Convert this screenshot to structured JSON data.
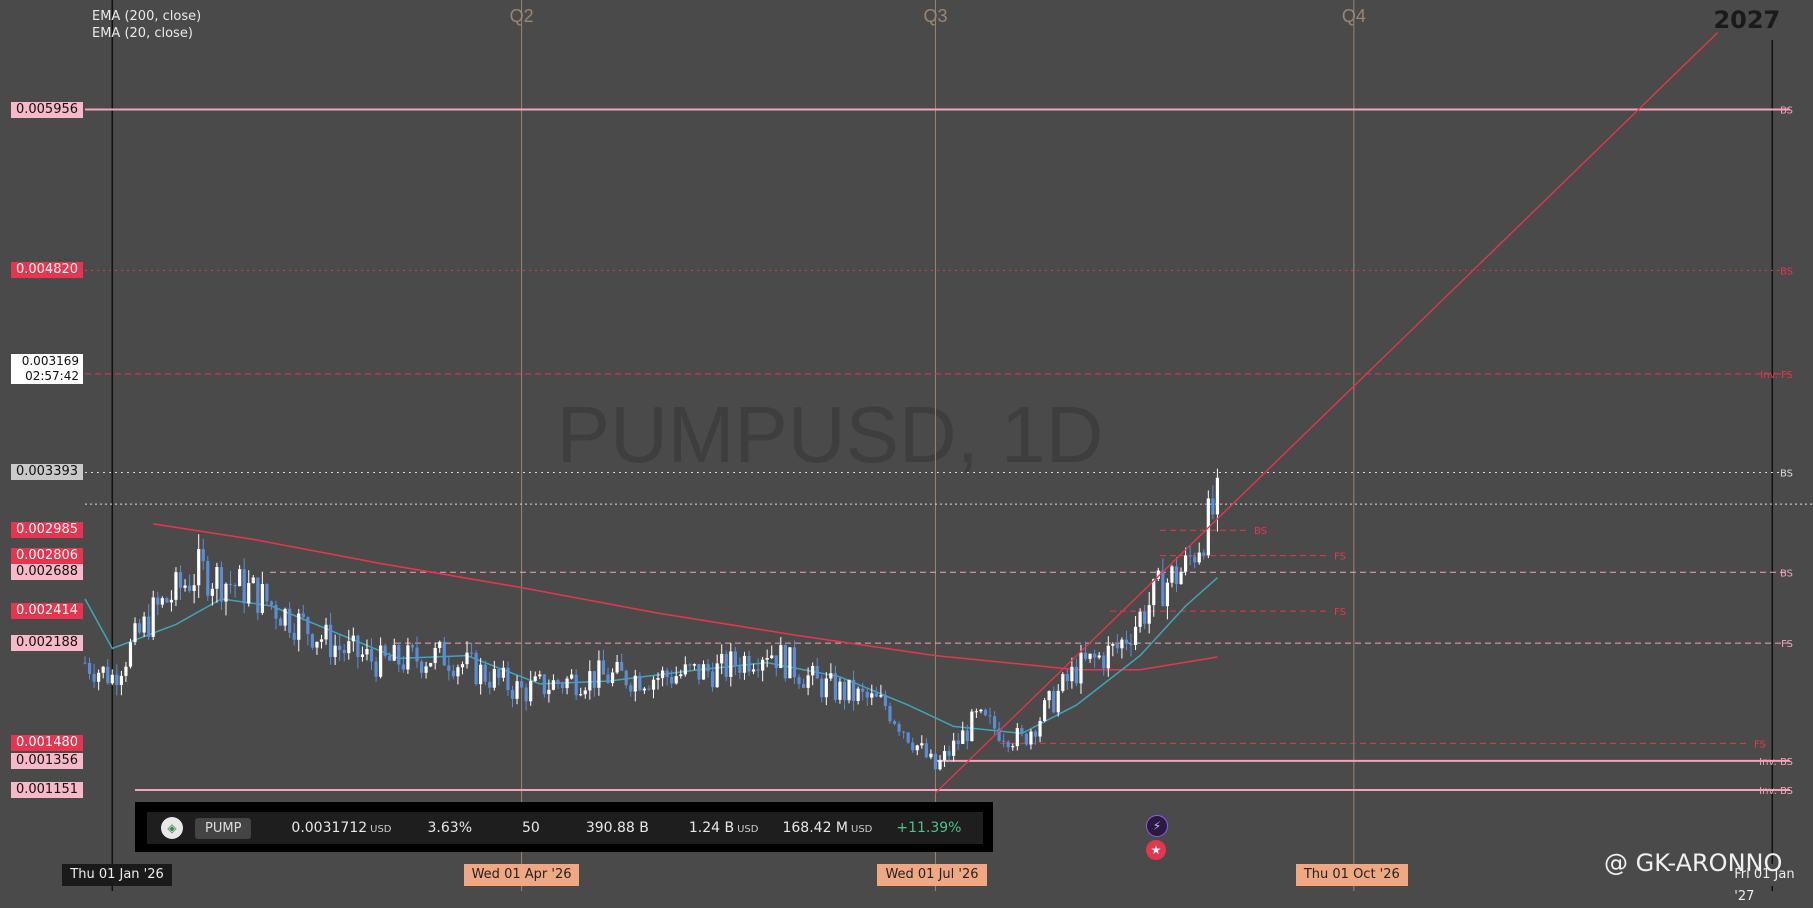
{
  "chart_data": {
    "type": "candlestick",
    "symbol": "PUMPUSD",
    "watermark": "PUMPUSD, 1D",
    "ylim": [
      0.00108,
      0.00656
    ],
    "x_range": [
      "2025-12-26",
      "2027-01-06"
    ],
    "indicators": [
      "EMA (200, close)",
      "EMA (20, close)"
    ],
    "candles_approx": [
      {
        "date": "2025-12-26",
        "close": 0.00205
      },
      {
        "date": "2026-01-01",
        "close": 0.00195
      },
      {
        "date": "2026-01-10",
        "close": 0.0024
      },
      {
        "date": "2026-01-20",
        "close": 0.0027
      },
      {
        "date": "2026-02-01",
        "close": 0.00255
      },
      {
        "date": "2026-02-10",
        "close": 0.00235
      },
      {
        "date": "2026-02-20",
        "close": 0.00215
      },
      {
        "date": "2026-03-01",
        "close": 0.00205
      },
      {
        "date": "2026-03-15",
        "close": 0.0021
      },
      {
        "date": "2026-04-01",
        "close": 0.00185
      },
      {
        "date": "2026-04-15",
        "close": 0.00195
      },
      {
        "date": "2026-05-01",
        "close": 0.00195
      },
      {
        "date": "2026-05-15",
        "close": 0.002
      },
      {
        "date": "2026-05-25",
        "close": 0.00215
      },
      {
        "date": "2026-06-05",
        "close": 0.0019
      },
      {
        "date": "2026-06-20",
        "close": 0.00175
      },
      {
        "date": "2026-07-01",
        "close": 0.0013
      },
      {
        "date": "2026-07-10",
        "close": 0.00165
      },
      {
        "date": "2026-07-20",
        "close": 0.0015
      },
      {
        "date": "2026-08-01",
        "close": 0.002
      },
      {
        "date": "2026-08-10",
        "close": 0.00215
      },
      {
        "date": "2026-08-20",
        "close": 0.0026
      },
      {
        "date": "2026-08-25",
        "close": 0.00272
      },
      {
        "date": "2026-09-01",
        "close": 0.00317
      }
    ],
    "levels": [
      {
        "price": "0.005956",
        "label": "BS",
        "style": "solid",
        "color": "#f4a3b8"
      },
      {
        "price": "0.004820",
        "label": "BS",
        "style": "dotted",
        "color": "#e8354f"
      },
      {
        "price": "0.004089",
        "label": "Inv. FS",
        "style": "dashed",
        "color": "#e8354f"
      },
      {
        "price": "0.003393",
        "label": "BS",
        "style": "dotted",
        "color": "#d8d8d8"
      },
      {
        "price": "0.002985",
        "label": "BS",
        "style": "short-dashed",
        "color": "#e8354f"
      },
      {
        "price": "0.002806",
        "label": "FS",
        "style": "short-dashed",
        "color": "#e8354f"
      },
      {
        "price": "0.002688",
        "label": "BS",
        "style": "dashed",
        "color": "#f4a3b8"
      },
      {
        "price": "0.002414",
        "label": "FS",
        "style": "short-dashed",
        "color": "#e8354f"
      },
      {
        "price": "0.002188",
        "label": "FS",
        "style": "dashed",
        "color": "#f4a3b8"
      },
      {
        "price": "0.001480",
        "label": "FS",
        "style": "dashed",
        "color": "#e8354f"
      },
      {
        "price": "0.001356",
        "label": "Inv. BS",
        "style": "solid",
        "color": "#f4a3b8"
      },
      {
        "price": "0.001151",
        "label": "Inv. BS",
        "style": "solid",
        "color": "#f4a3b8"
      }
    ],
    "current_price": "0.003169",
    "countdown": "02:57:42",
    "quarters": [
      "Q2",
      "Q3",
      "Q4"
    ],
    "year_label": "2027",
    "date_ticks": [
      "Thu 01 Jan '26",
      "Wed 01 Apr '26",
      "Wed 01 Jul '26",
      "Thu 01 Oct '26",
      "Fri 01 Jan '27"
    ],
    "trendline": {
      "from": {
        "date": "2026-07-01",
        "price": 0.00113
      },
      "to": {
        "date": "2026-12-20",
        "price": 0.0065
      }
    },
    "colors": {
      "background": "#4a4a4a",
      "candle": "#5b8dd6",
      "candle_up": "#ffffff",
      "ema20": "#3fa6b8",
      "ema200": "#e8354f",
      "quarter_line": "#9a8572"
    }
  },
  "infobar": {
    "symbol": "PUMP",
    "price": "0.0031712",
    "price_unit": "USD",
    "pct1": "3.63%",
    "count": "50",
    "supply": "390.88 B",
    "mcap": "1.24 B",
    "mcap_unit": "USD",
    "volume": "168.42 M",
    "volume_unit": "USD",
    "change": "+11.39%"
  },
  "watermark_handle": "@ GK-ARONNO"
}
